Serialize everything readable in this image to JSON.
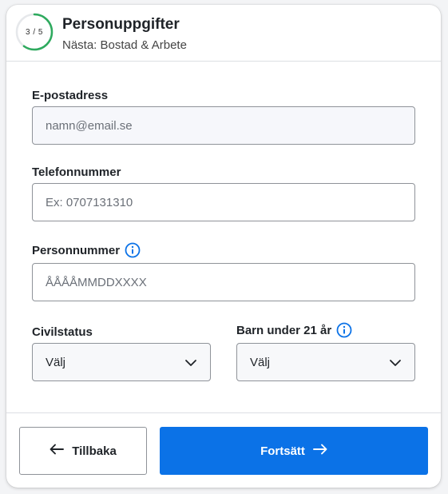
{
  "header": {
    "step_indicator": "3 / 5",
    "progress_fraction": 0.6,
    "title": "Personuppgifter",
    "subtitle": "Nästa: Bostad & Arbete"
  },
  "form": {
    "email": {
      "label": "E-postadress",
      "placeholder": "namn@email.se"
    },
    "phone": {
      "label": "Telefonnummer",
      "placeholder": "Ex: 0707131310"
    },
    "personal_number": {
      "label": "Personnummer",
      "placeholder": "ÅÅÅÅMMDDXXXX"
    },
    "civil_status": {
      "label": "Civilstatus",
      "value": "Välj"
    },
    "children": {
      "label": "Barn under 21 år",
      "value": "Välj"
    }
  },
  "footer": {
    "back_label": "Tillbaka",
    "next_label": "Fortsätt"
  },
  "colors": {
    "primary": "#0b72e7",
    "progress_green": "#2eaa5e",
    "info_blue": "#0b72e7"
  },
  "icons": {
    "info": "info-icon",
    "chevron": "chevron-down-icon",
    "back": "arrow-left-icon",
    "next": "arrow-right-icon"
  }
}
